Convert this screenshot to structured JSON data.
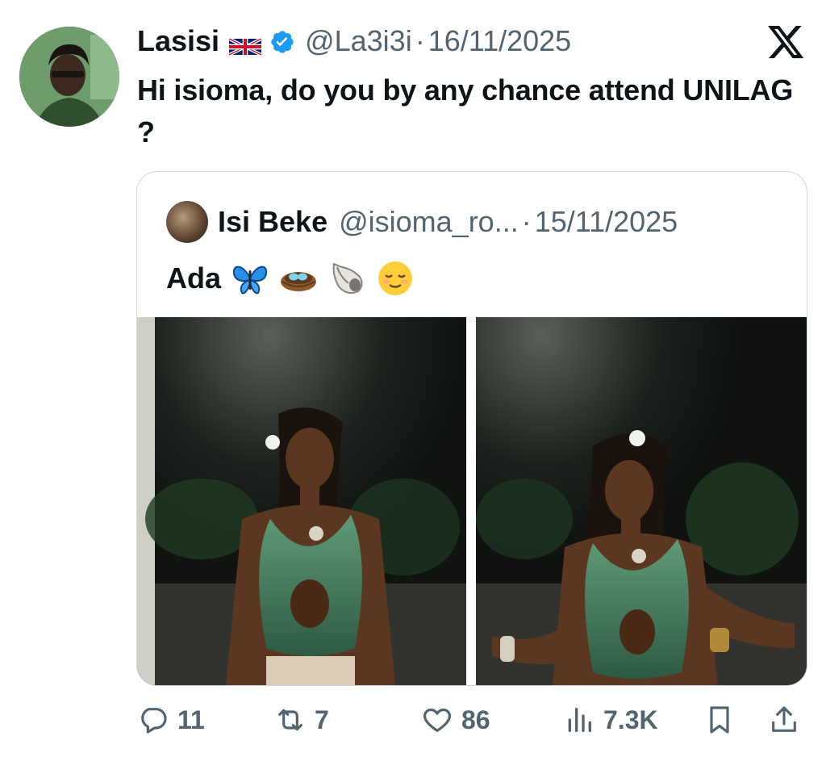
{
  "tweet": {
    "author": {
      "name": "Lasisi",
      "flag": "🇬🇧",
      "verified": true,
      "handle": "@La3i3i",
      "date": "16/11/2025"
    },
    "separator": "·",
    "text": "Hi isioma, do you by any chance attend UNILAG ?",
    "platform_icon": "x-logo-icon"
  },
  "quoted_tweet": {
    "author": {
      "name": "Isi Beke",
      "handle": "@isioma_ro...",
      "date": "15/11/2025"
    },
    "separator": "·",
    "text": "Ada",
    "emojis": [
      "butterfly-icon",
      "nest-with-eggs-icon",
      "spiral-shell-icon",
      "relieved-face-icon"
    ],
    "photos": [
      "photo-woman-green-halter-top-1",
      "photo-woman-green-halter-top-2"
    ]
  },
  "actions": {
    "replies": "11",
    "reposts": "7",
    "likes": "86",
    "views": "7.3K"
  },
  "colors": {
    "text": "#0f1419",
    "secondary": "#536471",
    "verified": "#1d9bf0",
    "border": "#cfd9de"
  }
}
